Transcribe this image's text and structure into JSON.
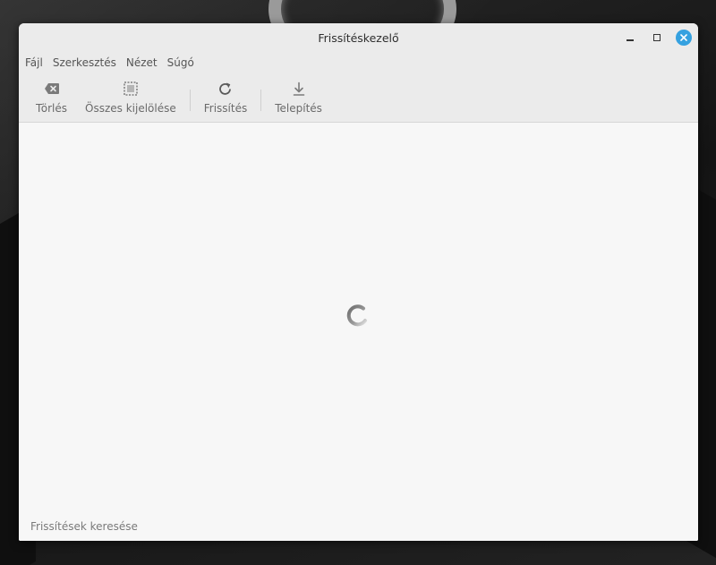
{
  "window": {
    "title": "Frissítéskezelő"
  },
  "menu": {
    "items": [
      {
        "label": "Fájl"
      },
      {
        "label": "Szerkesztés"
      },
      {
        "label": "Nézet"
      },
      {
        "label": "Súgó"
      }
    ]
  },
  "toolbar": {
    "clear_label": "Törlés",
    "select_all_label": "Összes kijelölése",
    "refresh_label": "Frissítés",
    "install_label": "Telepítés"
  },
  "status": {
    "text": "Frissítések keresése"
  },
  "colors": {
    "accent": "#35a1e0",
    "window_bg": "#f7f7f7",
    "chrome_bg": "#ebebeb"
  },
  "icons": [
    "backspace-icon",
    "select-all-icon",
    "refresh-icon",
    "download-icon",
    "minimize-icon",
    "maximize-icon",
    "close-icon",
    "loading-spinner-icon"
  ]
}
